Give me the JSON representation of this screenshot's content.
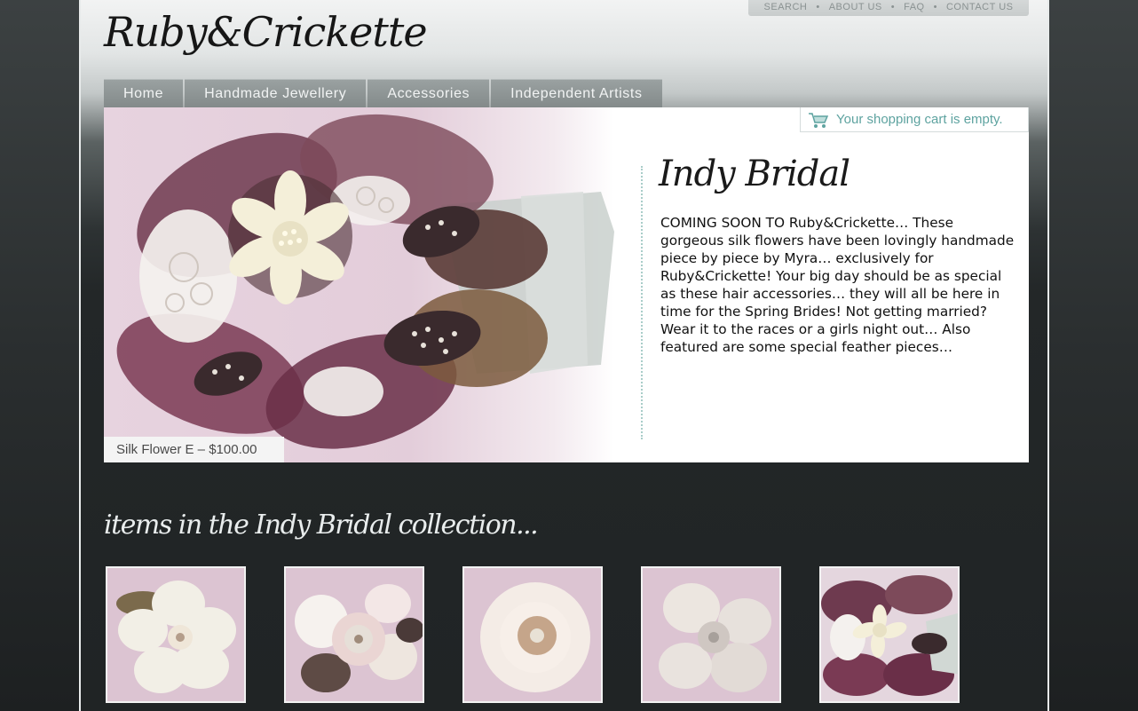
{
  "site": {
    "logo_text": "Ruby&Crickette"
  },
  "utility_nav": {
    "items": [
      "SEARCH",
      "ABOUT US",
      "FAQ",
      "CONTACT US"
    ],
    "separator": "•"
  },
  "main_nav": {
    "tabs": [
      "Home",
      "Handmade Jewellery",
      "Accessories",
      "Independent Artists"
    ]
  },
  "cart": {
    "status_text": "Your shopping cart is empty.",
    "icon": "shopping-cart-icon"
  },
  "hero": {
    "title": "Indy Bridal",
    "body": "COMING SOON TO Ruby&Crickette… These gorgeous silk flowers have been lovingly handmade piece by piece by Myra… exclusively for Ruby&Crickette! Your big day should be as special as these hair accessories… they will all be here in time for the Spring Brides! Not getting married? Wear it to the races or a girls night out… Also featured are some special feather pieces…",
    "image_caption": "Silk Flower E – $100.00"
  },
  "collection": {
    "title": "items in the Indy Bridal collection...",
    "thumbnails": [
      "thumb-1",
      "thumb-2",
      "thumb-3",
      "thumb-4",
      "thumb-5"
    ]
  },
  "colors": {
    "accent_teal": "#5ea3a0",
    "nav_tab": "#8f9696",
    "background_dark": "#202425",
    "photo_pink": "#e3cdda",
    "plum": "#7a3a54"
  }
}
